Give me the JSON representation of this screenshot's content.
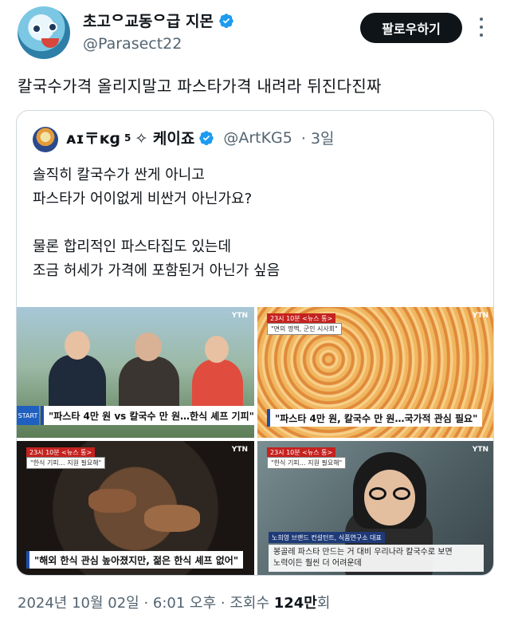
{
  "author": {
    "display_name": "초고ᄋ교동ᄋ급 지몬",
    "handle": "@Parasect22"
  },
  "follow_button_label": "팔로우하기",
  "tweet_text": "칼국수가격 올리지말고 파스타가격 내려라 뒤진다진짜",
  "quoted": {
    "display_name": "ᴀɪ〒ᴋɡ",
    "name_sup": "5",
    "name_suffix": "✧ 케이죠",
    "handle": "@ArtKG5",
    "time": "· 3일",
    "lines": [
      "솔직히 칼국수가 싼게 아니고",
      "파스타가 어이없게 비싼거 아닌가요?",
      "",
      "물론 합리적인 파스타집도 있는데",
      "조금 허세가 가격에 포함된거 아닌가 싶음"
    ]
  },
  "media": {
    "tile1": {
      "watermark": "YTN",
      "badge": "START",
      "caption": "\"파스타 4만 원 vs 칼국수 만 원…한식 셰프 기피\""
    },
    "tile2": {
      "watermark": "YTN",
      "tag": "\"면의 명맥, 군인 시사회\"",
      "caption": "\"파스타 4만 원, 칼국수 만 원…국가적 관심 필요\""
    },
    "tile3": {
      "watermark": "YTN",
      "tag": "\"한식 기피… 지원 필요해\"",
      "caption": "\"해외 한식 관심 높아졌지만, 젊은 한식 셰프 없어\""
    },
    "tile4": {
      "watermark": "YTN",
      "tag": "\"한식 기피… 지원 필요해\"",
      "name_strip": "노희영 브랜드 컨설턴트, 식품연구소 대표",
      "subtitle_1": "봉골레 파스타 만드는 거 대비 우리나라 칼국수로 보면",
      "subtitle_2": "노력이든 훨씬 더 어려운데"
    }
  },
  "footer": {
    "date_time": "2024년 10월 02일 · 6:01 오후 · 조회수 ",
    "views": "124만",
    "views_suffix": "회"
  },
  "colors": {
    "verified": "#1d9bf0",
    "text_primary": "#0f1419",
    "text_secondary": "#536471"
  }
}
